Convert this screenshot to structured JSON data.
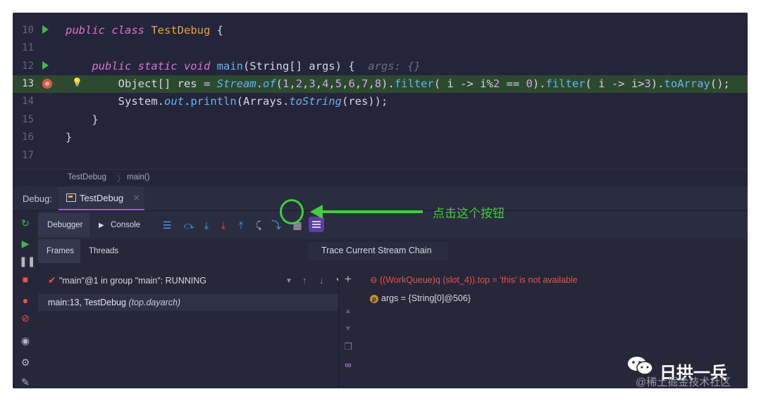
{
  "editor": {
    "lines": [
      {
        "num": "10",
        "code_html": "<span class='kw'>public class</span> <span class='cls'>TestDebug</span> {"
      },
      {
        "num": "11",
        "code_html": ""
      },
      {
        "num": "12",
        "code_html": "    <span class='kw'>public static void</span> <span class='fn'>main</span>(String[] args) {  <span class='hint'>args: {}</span>"
      },
      {
        "num": "13",
        "code_html": "        Object[] res = <span class='ita'>Stream</span>.<span class='ita'>of</span>(<span class='num'>1</span>,<span class='num'>2</span>,<span class='num'>3</span>,<span class='num'>4</span>,<span class='num'>5</span>,<span class='num'>6</span>,<span class='num'>7</span>,<span class='num'>8</span>).<span class='fn'>filter</span>( i -&gt; i%<span class='num'>2</span> == <span class='num'>0</span>).<span class='fn'>filter</span>( i -&gt; i&gt;<span class='num'>3</span>).<span class='fn'>toArray</span>();"
      },
      {
        "num": "14",
        "code_html": "        System.<span class='ita'>out</span>.<span class='fn'>println</span>(Arrays.<span class='ita'>toString</span>(res));"
      },
      {
        "num": "15",
        "code_html": "    }"
      },
      {
        "num": "16",
        "code_html": "}"
      },
      {
        "num": "17",
        "code_html": ""
      }
    ],
    "breadcrumb": [
      "TestDebug",
      "main()"
    ]
  },
  "debug": {
    "label": "Debug:",
    "tab": "TestDebug",
    "toolbar": {
      "debugger": "Debugger",
      "console": "Console"
    },
    "subtabs": {
      "frames": "Frames",
      "threads": "Threads"
    },
    "tooltip": "Trace Current Stream Chain",
    "thread": "\"main\"@1 in group \"main\": RUNNING",
    "frame_name": "main:13, TestDebug",
    "frame_pkg": "(top.dayarch)",
    "var_error": "((WorkQueue)q (slot_4)).top = 'this' is not available",
    "var_args": "args = {String[0]@506}"
  },
  "annotation": "点击这个按钮",
  "footer": {
    "account": "日拱一兵",
    "watermark": "@稀土掘金技术社区"
  },
  "colors": {
    "accent_green": "#3ecf3a",
    "breakpoint": "#e5534b",
    "highlight_line": "#2b4a2f"
  }
}
